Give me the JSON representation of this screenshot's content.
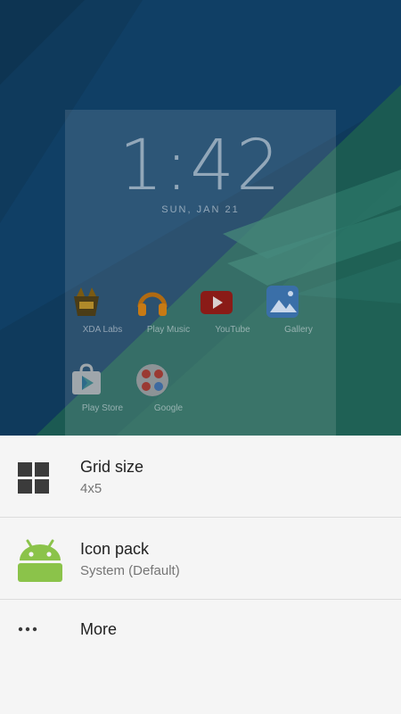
{
  "lockscreen": {
    "time": "1:42",
    "date": "SUN, JAN 21"
  },
  "apps": [
    {
      "label": "XDA Labs",
      "icon": "xda-labs-icon"
    },
    {
      "label": "Play Music",
      "icon": "headphones-icon"
    },
    {
      "label": "YouTube",
      "icon": "youtube-play-icon"
    },
    {
      "label": "Gallery",
      "icon": "gallery-icon"
    },
    {
      "label": "Play Store",
      "icon": "play-store-icon"
    },
    {
      "label": "Google",
      "icon": "google-folder-icon"
    }
  ],
  "settings": {
    "grid_size": {
      "title": "Grid size",
      "value": "4x5",
      "icon": "grid-icon"
    },
    "icon_pack": {
      "title": "Icon pack",
      "value": "System (Default)",
      "icon": "android-icon"
    },
    "more": {
      "title": "More",
      "icon": "more-dots-icon"
    }
  },
  "colors": {
    "sheet_bg": "#f5f5f5",
    "android_green": "#8bc34a",
    "wallpaper_blue": "#0f3a5c",
    "wallpaper_teal": "#1f6155"
  }
}
